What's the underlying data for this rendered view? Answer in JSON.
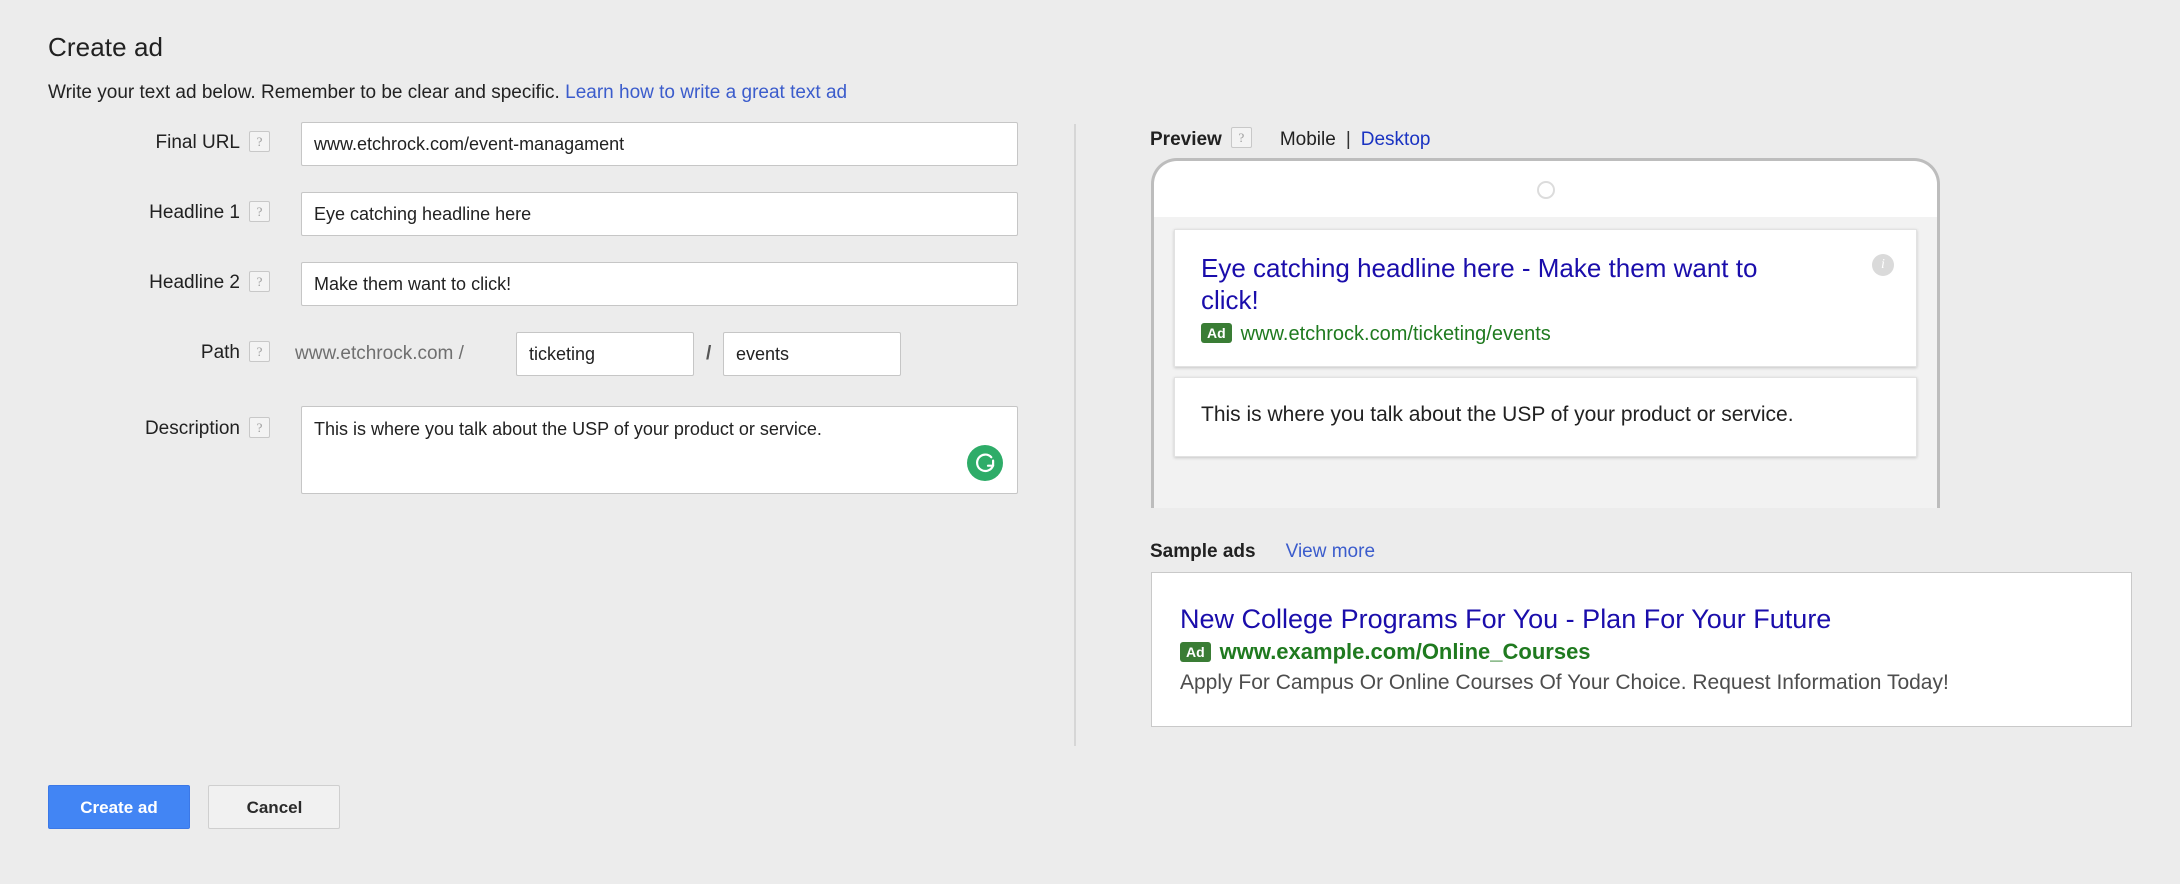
{
  "header": {
    "title": "Create ad",
    "subtitle": "Write your text ad below. Remember to be clear and specific.",
    "help_link": "Learn how to write a great text ad"
  },
  "help_icon_glyph": "?",
  "form": {
    "final_url": {
      "label": "Final URL",
      "value": "www.etchrock.com/event-managament"
    },
    "headline1": {
      "label": "Headline 1",
      "value": "Eye catching headline here"
    },
    "headline2": {
      "label": "Headline 2",
      "value": "Make them want to click!"
    },
    "path": {
      "label": "Path",
      "domain_prefix": "www.etchrock.com /",
      "separator": "/",
      "path1_value": "ticketing",
      "path2_value": "events"
    },
    "description": {
      "label": "Description",
      "value": "This is where you talk about the USP of your product or service.",
      "grammarly_icon": "grammarly-icon"
    }
  },
  "preview": {
    "title": "Preview",
    "tab_mobile": "Mobile",
    "tab_separator": "|",
    "tab_desktop": "Desktop",
    "selected_tab": "Mobile",
    "ad": {
      "headline": "Eye catching headline here - Make them want to click!",
      "badge": "Ad",
      "url": "www.etchrock.com/ticketing/events",
      "description": "This is where you talk about the USP of your product or service.",
      "info_icon": "info-icon"
    }
  },
  "sample_ads": {
    "title": "Sample ads",
    "view_more": "View more",
    "items": [
      {
        "headline": "New College Programs For You - Plan For Your Future",
        "badge": "Ad",
        "url": "www.example.com/Online_Courses",
        "description": "Apply For Campus Or Online Courses Of Your Choice. Request Information Today!"
      }
    ]
  },
  "footer": {
    "create_label": "Create ad",
    "cancel_label": "Cancel"
  },
  "colors": {
    "page_bg": "#ececec",
    "primary_button": "#4285f4",
    "link": "#3b5ccc",
    "ad_headline": "#1a0dab",
    "ad_url_green": "#1f7a1f",
    "ad_badge_green": "#3a7d35",
    "grammarly_green": "#2eac68"
  }
}
